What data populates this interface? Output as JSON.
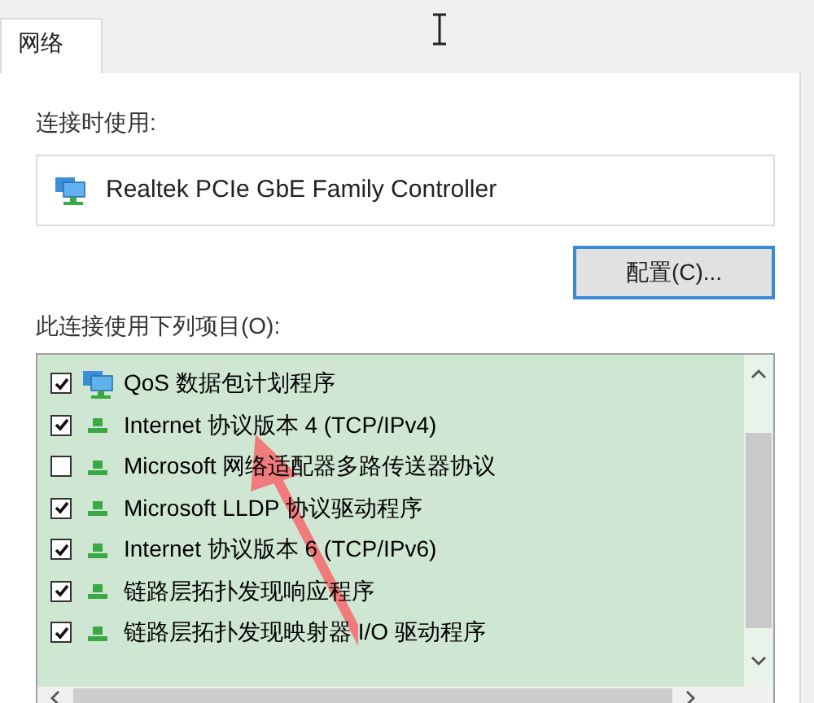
{
  "tabs": [
    {
      "label": "网络",
      "selected": true
    }
  ],
  "connect_using": {
    "label": "连接时使用:",
    "adapter": "Realtek PCIe GbE Family Controller"
  },
  "configure_button": "配置(C)...",
  "items_label": "此连接使用下列项目(O):",
  "items": [
    {
      "kind": "service",
      "label": "QoS 数据包计划程序",
      "checked": true
    },
    {
      "kind": "protocol",
      "label": "Internet 协议版本 4 (TCP/IPv4)",
      "checked": true
    },
    {
      "kind": "protocol",
      "label": "Microsoft 网络适配器多路传送器协议",
      "checked": false
    },
    {
      "kind": "protocol",
      "label": "Microsoft LLDP 协议驱动程序",
      "checked": true
    },
    {
      "kind": "protocol",
      "label": "Internet 协议版本 6 (TCP/IPv6)",
      "checked": true
    },
    {
      "kind": "protocol",
      "label": "链路层拓扑发现响应程序",
      "checked": true
    },
    {
      "kind": "protocol",
      "label": "链路层拓扑发现映射器 I/O 驱动程序",
      "checked": true
    }
  ]
}
